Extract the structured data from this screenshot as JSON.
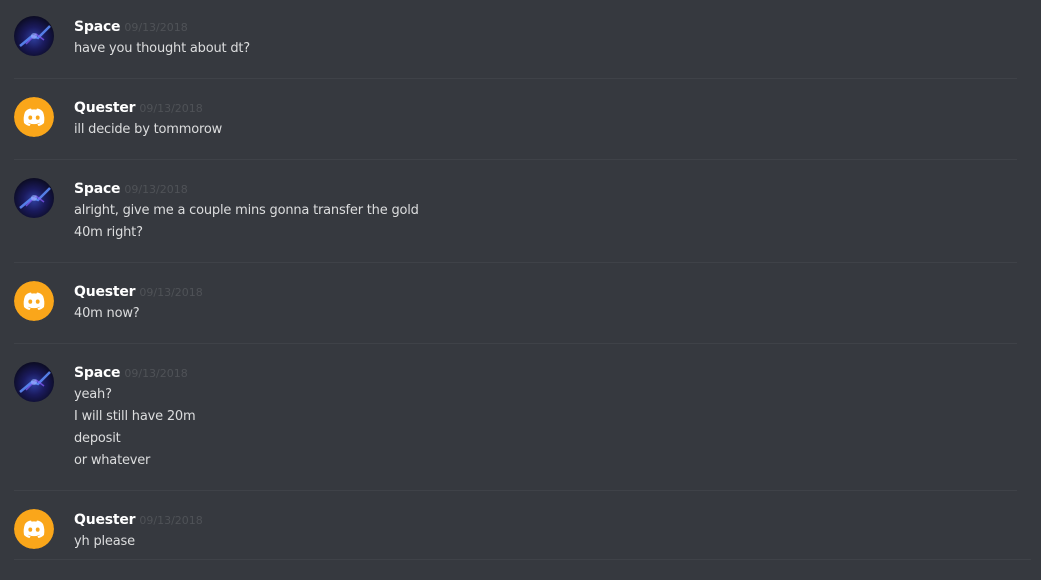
{
  "messages": [
    {
      "author": "Space",
      "timestamp": "09/13/2018",
      "avatar": "space-avatar",
      "lines": [
        "have you thought about dt?"
      ]
    },
    {
      "author": "Quester",
      "timestamp": "09/13/2018",
      "avatar": "discord-logo-avatar",
      "lines": [
        "ill decide by tommorow"
      ]
    },
    {
      "author": "Space",
      "timestamp": "09/13/2018",
      "avatar": "space-avatar",
      "lines": [
        "alright, give me a couple mins gonna transfer the gold",
        "40m right?"
      ]
    },
    {
      "author": "Quester",
      "timestamp": "09/13/2018",
      "avatar": "discord-logo-avatar",
      "lines": [
        "40m now?"
      ]
    },
    {
      "author": "Space",
      "timestamp": "09/13/2018",
      "avatar": "space-avatar",
      "lines": [
        "yeah?",
        "I will still have 20m",
        "deposit",
        "or whatever"
      ]
    },
    {
      "author": "Quester",
      "timestamp": "09/13/2018",
      "avatar": "discord-logo-avatar",
      "lines": [
        "yh please"
      ]
    }
  ],
  "colors": {
    "background": "#36393f",
    "username": "#ffffff",
    "timestamp": "#4f5257",
    "message_text": "#dcddde",
    "divider": "#3f4248",
    "discord_avatar": "#faa61a"
  }
}
